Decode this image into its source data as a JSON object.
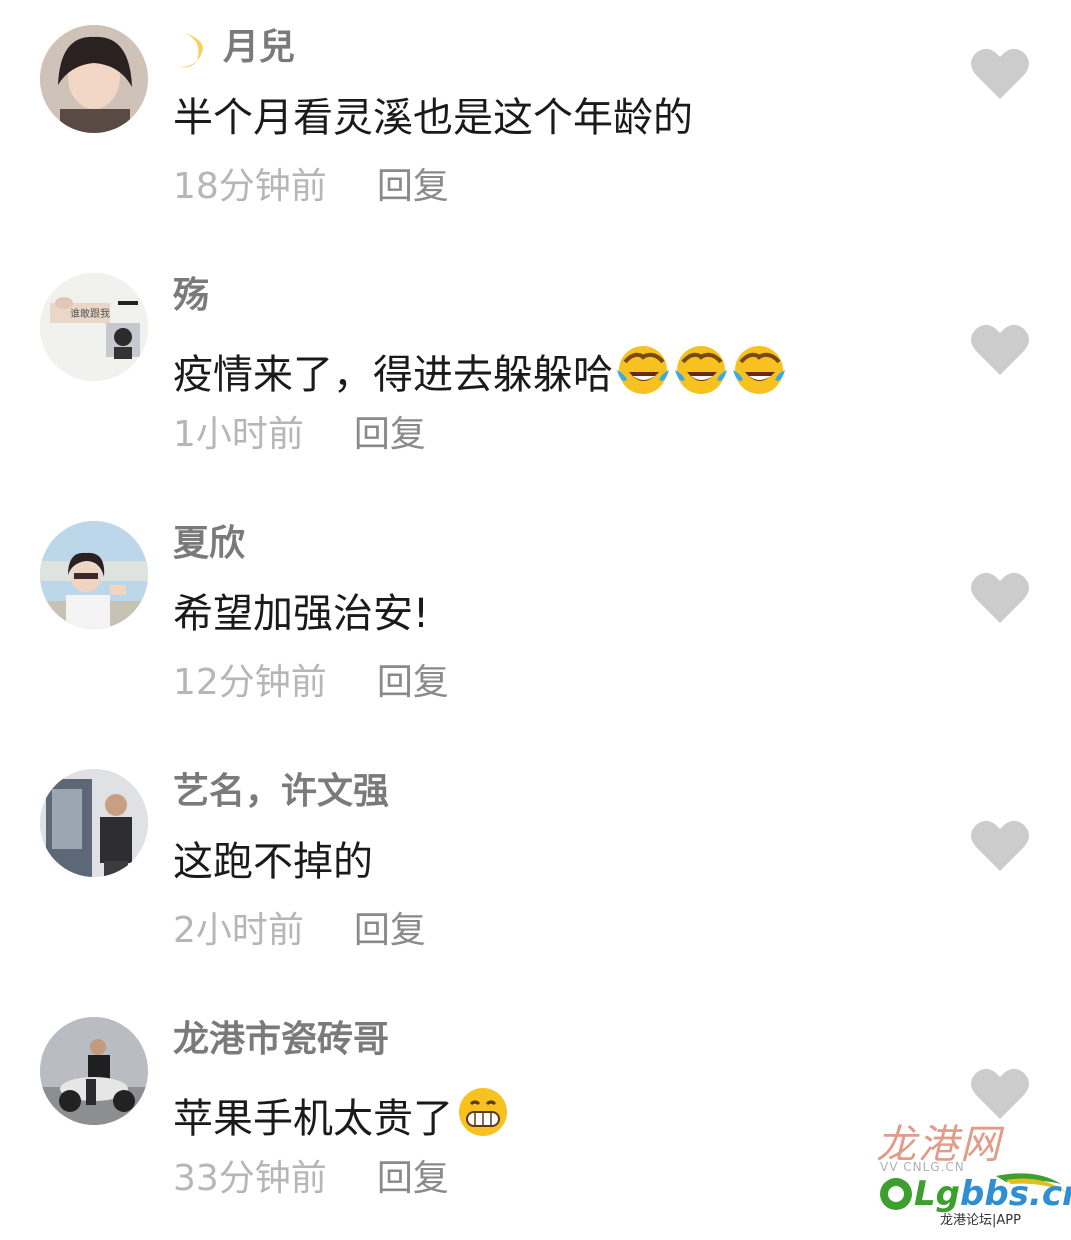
{
  "comments": [
    {
      "name": "月兒",
      "has_moon": true,
      "text": "半个月看灵溪也是这个年龄的",
      "time": "18分钟前",
      "reply": "回复",
      "avatar": "avatar-woman-1"
    },
    {
      "name": "殇",
      "has_moon": false,
      "text": "疫情来了，得进去躲躲哈",
      "emojis": [
        "laughing-tears-emoji",
        "laughing-tears-emoji",
        "laughing-tears-emoji"
      ],
      "time": "1小时前",
      "reply": "回复",
      "avatar": "avatar-sign-photo"
    },
    {
      "name": "夏欣",
      "has_moon": false,
      "text": "希望加强治安!",
      "time": "12分钟前",
      "reply": "回复",
      "avatar": "avatar-woman-sunglasses"
    },
    {
      "name": "艺名，许文强",
      "has_moon": false,
      "text": "这跑不掉的",
      "time": "2小时前",
      "reply": "回复",
      "avatar": "avatar-man-standing"
    },
    {
      "name": "龙港市瓷砖哥",
      "has_moon": false,
      "text": "苹果手机太贵了",
      "emojis": [
        "grin-emoji"
      ],
      "time": "33分钟前",
      "reply": "回复",
      "avatar": "avatar-man-motorcycle"
    }
  ],
  "watermark": {
    "cn": "龙港网",
    "small": "VV  CNLG.CN",
    "brand_prefix": "Lg",
    "brand_suffix": "bbs.cn",
    "sub": "龙港论坛|APP"
  },
  "colors": {
    "name": "#7a7a7a",
    "text": "#1a1a1a",
    "meta": "#b6b6b6",
    "heart": "#cccccc"
  }
}
